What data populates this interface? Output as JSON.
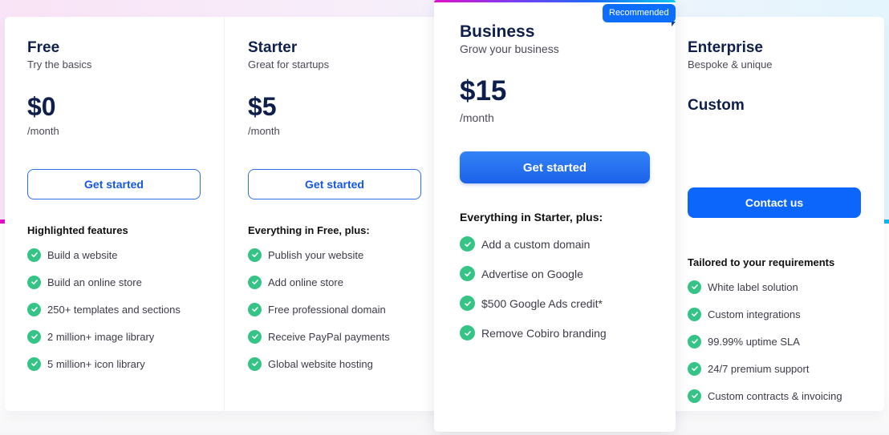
{
  "plans": [
    {
      "name": "Free",
      "tagline": "Try the basics",
      "price": "$0",
      "period": "/month",
      "cta": "Get started",
      "features_heading": "Highlighted features",
      "features": [
        "Build a website",
        "Build an online store",
        "250+ templates and sections",
        "2 million+ image library",
        "5 million+ icon library"
      ]
    },
    {
      "name": "Starter",
      "tagline": "Great for startups",
      "price": "$5",
      "period": "/month",
      "cta": "Get started",
      "features_heading": "Everything in Free, plus:",
      "features": [
        "Publish your website",
        "Add online store",
        "Free professional domain",
        "Receive PayPal payments",
        "Global website hosting"
      ]
    },
    {
      "name": "Business",
      "tagline": "Grow your business",
      "price": "$15",
      "period": "/month",
      "badge": "Recommended",
      "cta": "Get started",
      "features_heading": "Everything in Starter, plus:",
      "features": [
        "Add a custom domain",
        "Advertise on Google",
        "$500 Google Ads credit*",
        "Remove Cobiro branding"
      ]
    },
    {
      "name": "Enterprise",
      "tagline": "Bespoke & unique",
      "price": "Custom",
      "cta": "Contact us",
      "features_heading": "Tailored to your requirements",
      "features": [
        "White label solution",
        "Custom integrations",
        "99.99% uptime SLA",
        "24/7 premium support",
        "Custom contracts & invoicing"
      ]
    }
  ],
  "icons": {
    "feature_check": "check-circle-icon"
  },
  "colors": {
    "accent": "#0d66fb",
    "check": "#35c486",
    "heading": "#0e1f4d"
  }
}
